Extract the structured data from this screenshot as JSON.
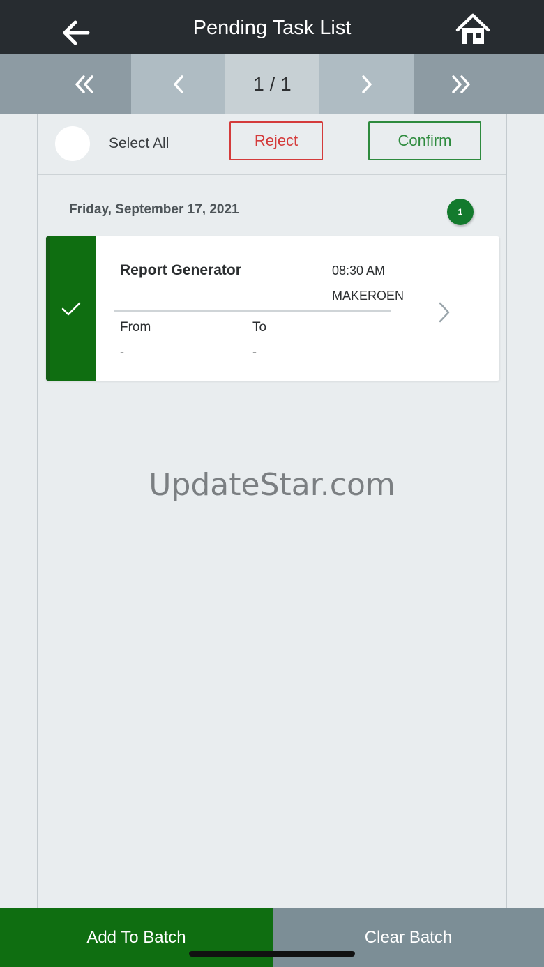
{
  "header": {
    "title": "Pending Task List",
    "back_icon": "arrow-left-icon",
    "home_icon": "home-icon"
  },
  "pager": {
    "page_indicator": "1 / 1",
    "first_icon": "double-chevron-left-icon",
    "prev_icon": "chevron-left-icon",
    "next_icon": "chevron-right-icon",
    "last_icon": "double-chevron-right-icon"
  },
  "actions": {
    "select_all_label": "Select All",
    "reject_label": "Reject",
    "confirm_label": "Confirm"
  },
  "group": {
    "date": "Friday, September 17, 2021",
    "count": "1"
  },
  "task": {
    "name": "Report Generator",
    "time": "08:30 AM",
    "user": "MAKEROEN",
    "from_label": "From",
    "to_label": "To",
    "from_value": "-",
    "to_value": "-",
    "selected": true
  },
  "watermark": "UpdateStar.com",
  "bottom": {
    "add_label": "Add To Batch",
    "clear_label": "Clear Batch"
  },
  "colors": {
    "topbar": "#272c30",
    "accent_green": "#0f6e11",
    "reject_red": "#d43b3b",
    "confirm_green": "#2e8b3e",
    "clear_gray": "#7c8e96"
  }
}
